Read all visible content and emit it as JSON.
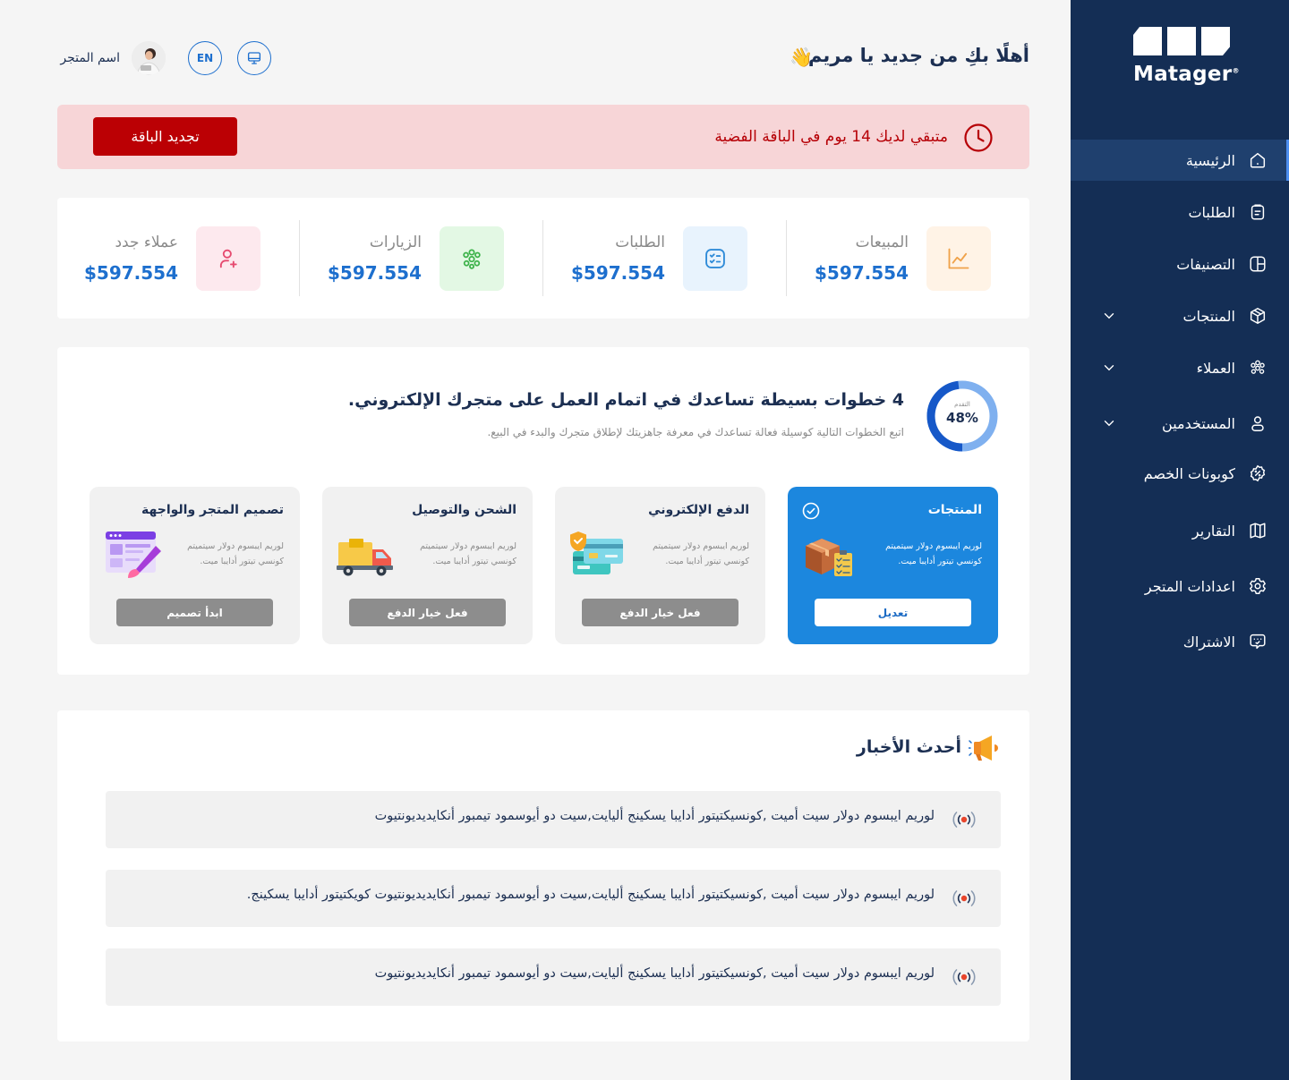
{
  "brand": {
    "name": "Matager",
    "mark": "®"
  },
  "sidebar": {
    "items": [
      {
        "label": "الرئيسية",
        "icon": "home-icon",
        "active": true,
        "has_chevron": false
      },
      {
        "label": "الطلبات",
        "icon": "orders-icon",
        "active": false,
        "has_chevron": false
      },
      {
        "label": "التصنيفات",
        "icon": "categories-icon",
        "active": false,
        "has_chevron": false
      },
      {
        "label": "المنتجات",
        "icon": "box-icon",
        "active": false,
        "has_chevron": true
      },
      {
        "label": "العملاء",
        "icon": "customers-icon",
        "active": false,
        "has_chevron": true
      },
      {
        "label": "المستخدمين",
        "icon": "user-icon",
        "active": false,
        "has_chevron": true
      },
      {
        "label": "كوبونات الخصم",
        "icon": "coupon-icon",
        "active": false,
        "has_chevron": false
      },
      {
        "label": "التقارير",
        "icon": "reports-icon",
        "active": false,
        "has_chevron": false
      },
      {
        "label": "اعدادات المتجر",
        "icon": "gear-icon",
        "active": false,
        "has_chevron": false
      },
      {
        "label": "الاشتراك",
        "icon": "subscription-icon",
        "active": false,
        "has_chevron": false
      }
    ]
  },
  "header": {
    "greeting": "أهلًا بكِ من جديد يا مريم",
    "wave_emoji": "👋",
    "language": "EN",
    "store_name": "اسم المتجر"
  },
  "banner": {
    "text": "متبقي لديك 14 يوم في الباقة الفضية",
    "button": "تجديد الباقة"
  },
  "stats": [
    {
      "label": "المبيعات",
      "value": "$597.554",
      "icon": "chart-icon",
      "tint": "#fff3e6",
      "color": "#f0a24a"
    },
    {
      "label": "الطلبات",
      "value": "$597.554",
      "icon": "checklist-icon",
      "tint": "#e8f3fd",
      "color": "#2f8bd8"
    },
    {
      "label": "الزيارات",
      "value": "$597.554",
      "icon": "visitors-icon",
      "tint": "#e3f8e4",
      "color": "#3cb249"
    },
    {
      "label": "عملاء جدد",
      "value": "$597.554",
      "icon": "add-user-icon",
      "tint": "#fde9ee",
      "color": "#e64a6f"
    }
  ],
  "steps": {
    "progress_label": "التقدم",
    "progress_value": "48%",
    "progress_fraction": 0.48,
    "title": "4 خطوات بسيطة تساعدك في اتمام العمل على متجرك الإلكتروني.",
    "subtitle": "اتبع الخطوات التالية كوسيلة فعالة تساعدك في معرفة جاهزيتك لإطلاق متجرك والبدء في البيع.",
    "cards": [
      {
        "title": "المنتجات",
        "desc": "لوريم ايبسوم دولار سيتميتم كونسي تيتور أدايبا ميت.",
        "button": "تعديل",
        "active": true
      },
      {
        "title": "الدفع الإلكتروني",
        "desc": "لوريم ايبسوم دولار سيتميتم كونسي تيتور أدايبا ميت.",
        "button": "فعل خيار الدفع",
        "active": false
      },
      {
        "title": "الشحن والتوصيل",
        "desc": "لوريم ايبسوم دولار سيتميتم كونسي تيتور أدايبا ميت.",
        "button": "فعل خيار الدفع",
        "active": false
      },
      {
        "title": "تصميم المتجر والواجهة",
        "desc": "لوريم ايبسوم دولار سيتميتم كونسي تيتور أدايبا ميت.",
        "button": "ابدأ تصميم",
        "active": false
      }
    ]
  },
  "news": {
    "title": "أحدث الأخبار",
    "items": [
      "لوريم ايبسوم دولار سيت أميت ,كونسيكتيتور أدايبا يسكينج أليايت,سيت دو أيوسمود تيمبور أنكايديديونتيوت",
      "لوريم ايبسوم دولار سيت أميت ,كونسيكتيتور أدايبا يسكينج أليايت,سيت دو أيوسمود تيمبور أنكايديديونتيوت كويكتيتور أدايبا يسكينج.",
      "لوريم ايبسوم دولار سيت أميت ,كونسيكتيتور أدايبا يسكينج أليايت,سيت دو أيوسمود تيمبور أنكايديديونتيوت"
    ]
  }
}
